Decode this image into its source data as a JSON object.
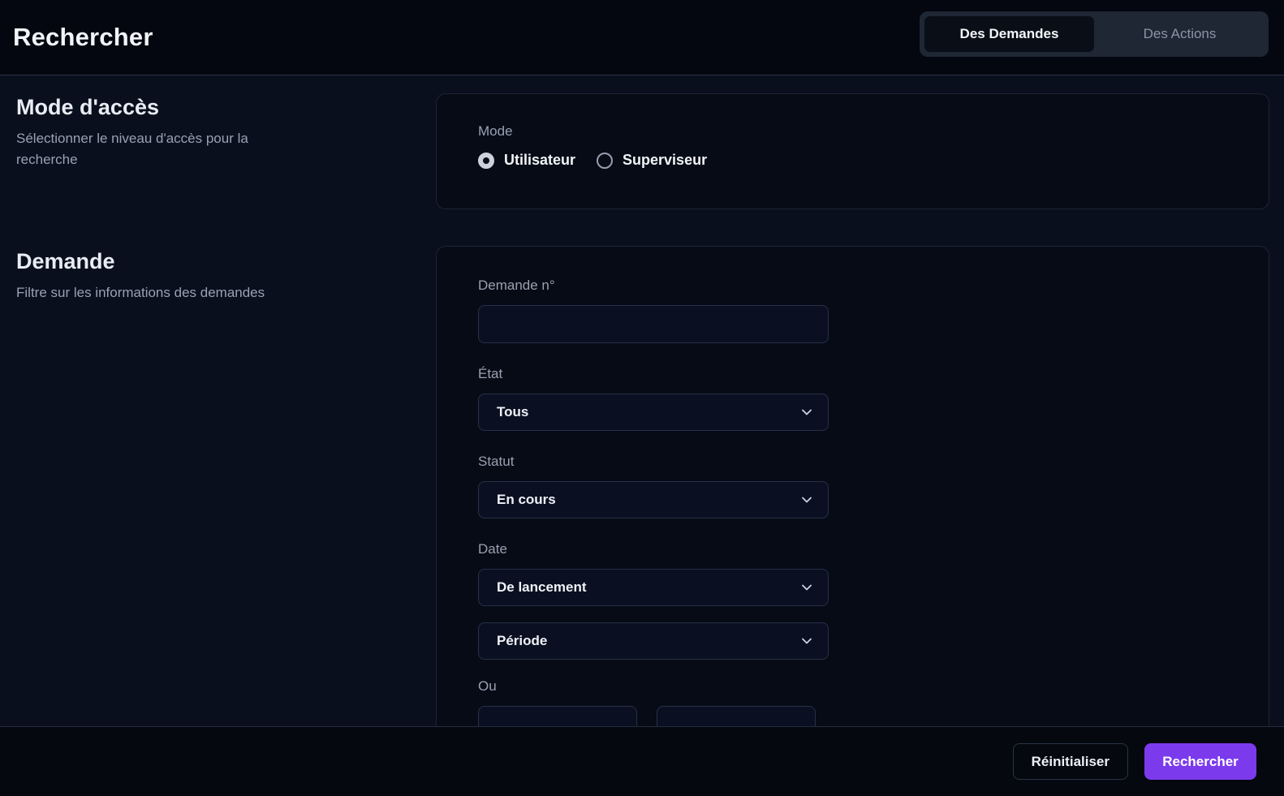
{
  "header": {
    "title": "Rechercher",
    "tabs": [
      {
        "label": "Des Demandes",
        "active": true
      },
      {
        "label": "Des Actions",
        "active": false
      }
    ]
  },
  "sections": {
    "access": {
      "title": "Mode d'accès",
      "description": "Sélectionner le niveau d'accès pour la recherche"
    },
    "demande": {
      "title": "Demande",
      "description": "Filtre sur les informations des demandes"
    }
  },
  "mode_card": {
    "label": "Mode",
    "options": [
      {
        "label": "Utilisateur",
        "selected": true
      },
      {
        "label": "Superviseur",
        "selected": false
      }
    ]
  },
  "form": {
    "demande_no": {
      "label": "Demande n°",
      "value": "",
      "placeholder": ""
    },
    "etat": {
      "label": "État",
      "value": "Tous"
    },
    "statut": {
      "label": "Statut",
      "value": "En cours"
    },
    "date": {
      "label": "Date",
      "value": "De lancement"
    },
    "periode": {
      "value": "Période"
    },
    "ou_label": "Ou"
  },
  "footer": {
    "reset_label": "Réinitialiser",
    "search_label": "Rechercher"
  },
  "colors": {
    "accent": "#7c3aed",
    "background": "#0a0f1d",
    "card": "#070b15"
  }
}
